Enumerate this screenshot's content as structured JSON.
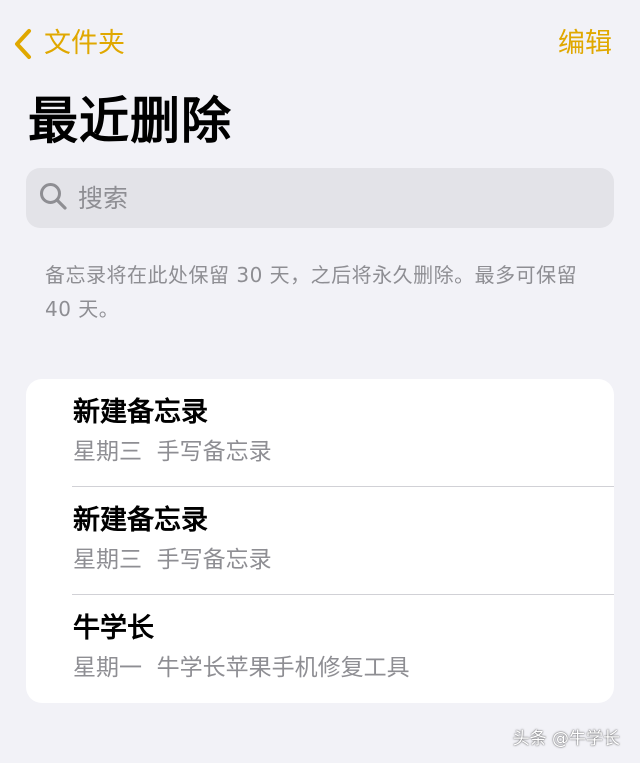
{
  "nav": {
    "back_label": "文件夹",
    "edit_label": "编辑"
  },
  "page": {
    "title": "最近删除"
  },
  "search": {
    "placeholder": "搜索"
  },
  "notice": {
    "text": "备忘录将在此处保留 30 天，之后将永久删除。最多可保留 40 天。"
  },
  "notes": [
    {
      "title": "新建备忘录",
      "date": "星期三",
      "preview": "手写备忘录"
    },
    {
      "title": "新建备忘录",
      "date": "星期三",
      "preview": "手写备忘录"
    },
    {
      "title": "牛学长",
      "date": "星期一",
      "preview": "牛学长苹果手机修复工具"
    }
  ],
  "watermark": "头条 @牛学长",
  "colors": {
    "accent": "#e0a800",
    "background": "#f2f2f7",
    "secondary_text": "#8e8e93"
  }
}
